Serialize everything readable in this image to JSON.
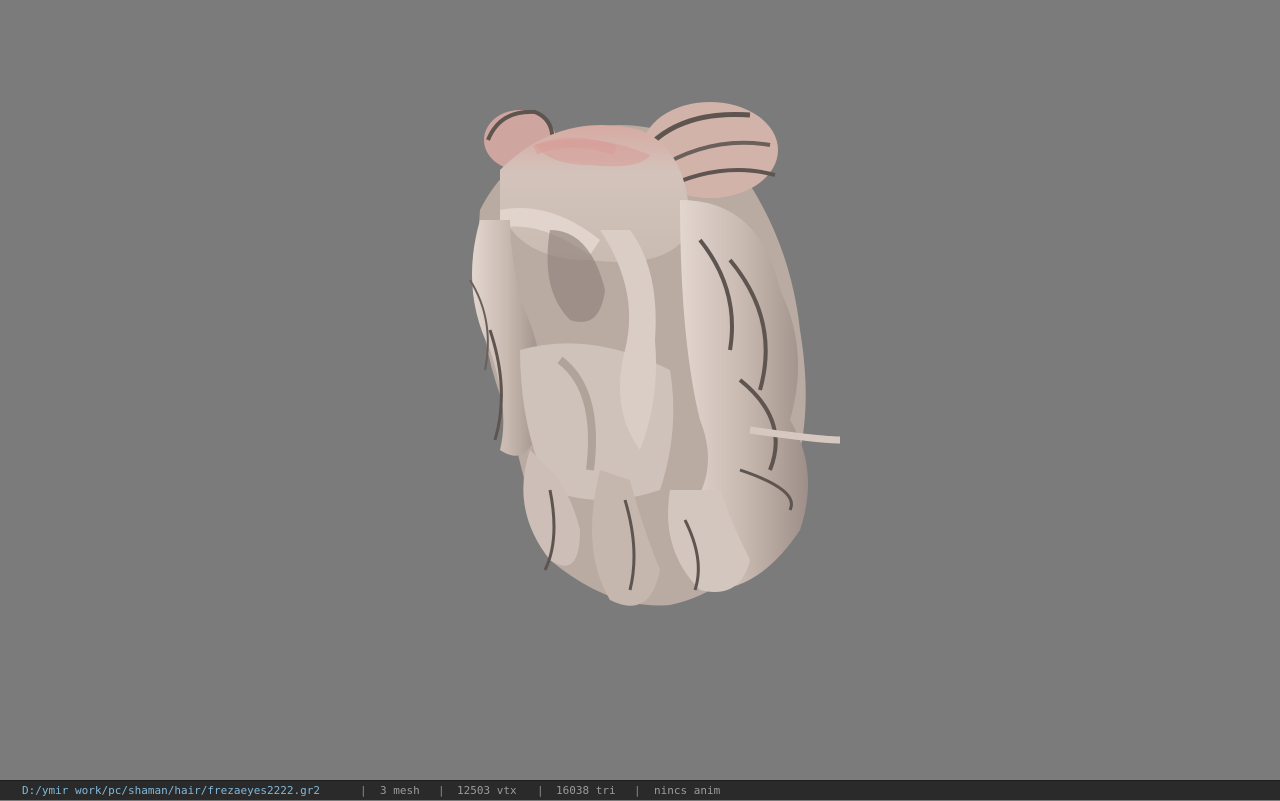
{
  "viewport": {
    "background": "#7b7b7b",
    "model_subject": "hair-mesh",
    "model_colors": {
      "base": "#cdbfb7",
      "root_tint": "#d9a9a2",
      "shadow": "#5e5450"
    }
  },
  "statusbar": {
    "file_path": "D:/ymir work/pc/shaman/hair/frezaeyes2222.gr2",
    "separator": "|",
    "mesh_count": "3 mesh",
    "vertex_count": "12503 vtx",
    "triangle_count": "16038 tri",
    "anim_status": "nincs anim",
    "path_color": "#7fb7d9",
    "text_color": "#9a9a9a"
  }
}
